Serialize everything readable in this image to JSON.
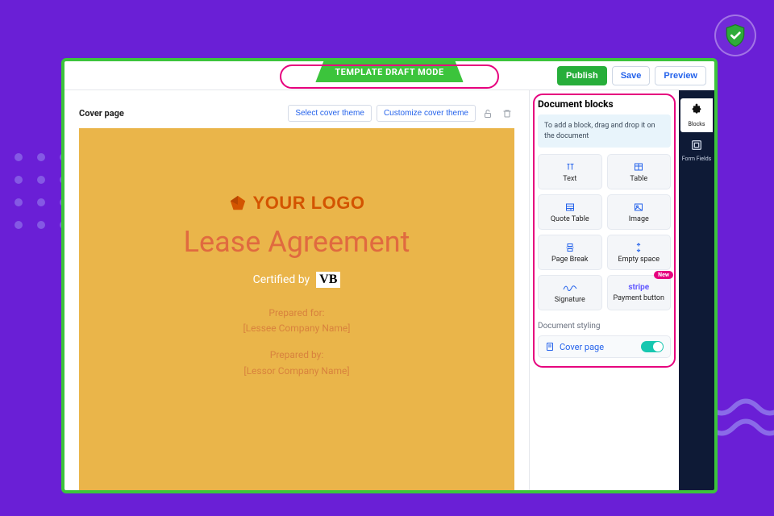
{
  "mode_badge": "TEMPLATE DRAFT MODE",
  "toolbar": {
    "publish": "Publish",
    "save": "Save",
    "preview": "Preview"
  },
  "canvas": {
    "section_label": "Cover page",
    "select_theme": "Select cover theme",
    "customize_theme": "Customize cover theme"
  },
  "cover": {
    "logo_text": "YOUR LOGO",
    "title": "Lease Agreement",
    "certified_prefix": "Certified by",
    "certified_mark": "VB",
    "prepared_for_label": "Prepared for:",
    "prepared_for_value": "[Lessee Company Name]",
    "prepared_by_label": "Prepared by:",
    "prepared_by_value": "[Lessor Company Name]"
  },
  "panel": {
    "title": "Document blocks",
    "tip": "To add a block, drag and drop it on the document",
    "blocks": [
      {
        "label": "Text"
      },
      {
        "label": "Table"
      },
      {
        "label": "Quote Table"
      },
      {
        "label": "Image"
      },
      {
        "label": "Page Break"
      },
      {
        "label": "Empty space"
      },
      {
        "label": "Signature"
      },
      {
        "label": "Payment button"
      }
    ],
    "new_badge": "New",
    "stripe": "stripe",
    "styling_label": "Document styling",
    "cover_toggle_label": "Cover page"
  },
  "rail": {
    "blocks": "Blocks",
    "form_fields": "Form Fields"
  }
}
